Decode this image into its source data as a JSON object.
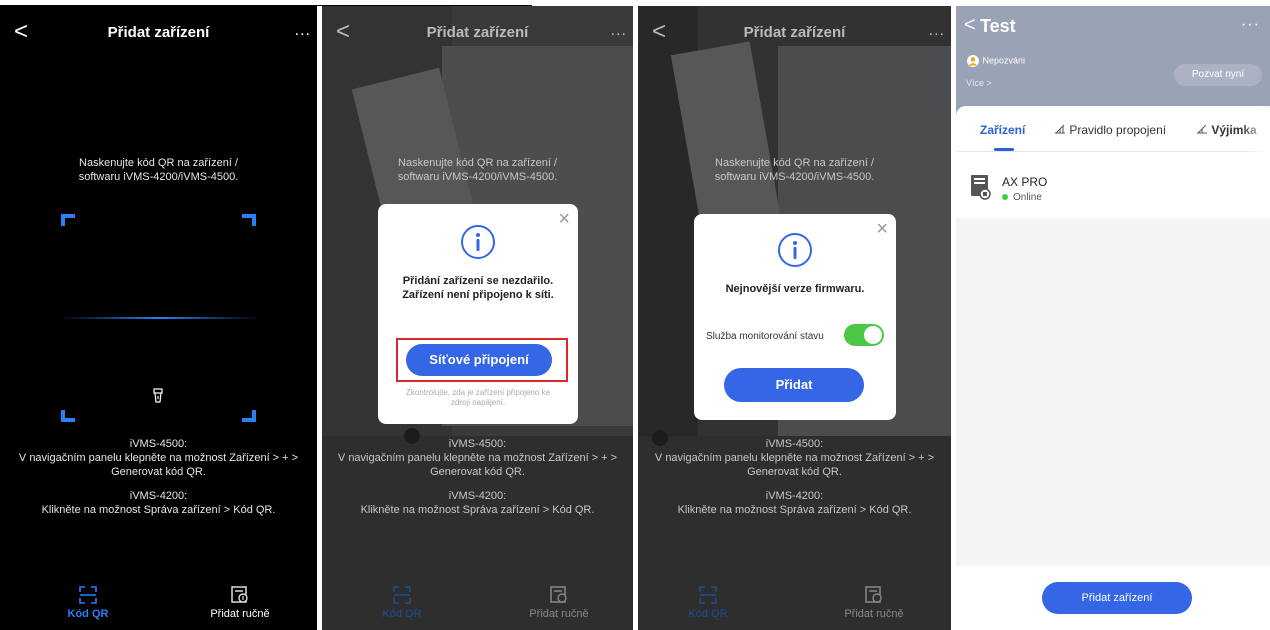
{
  "panel1": {
    "header": {
      "back": "<",
      "title": "Přidat zařízení",
      "more": "..."
    },
    "instruction_lines": [
      "Naskenujte kód QR na zařízení /",
      "softwaru iVMS-4200/iVMS-4500."
    ],
    "help": {
      "ivms4500_title": "iVMS-4500:",
      "ivms4500_line1": "V navigačním panelu klepněte na možnost Zařízení > + >",
      "ivms4500_line2": "Generovat kód QR.",
      "ivms4200_title": "iVMS-4200:",
      "ivms4200_line1": "Klikněte na možnost Správa zařízení > Kód QR."
    },
    "tabs": [
      {
        "label": "Kód QR",
        "icon": "qr-scan-icon",
        "active": true
      },
      {
        "label": "Přidat ručně",
        "icon": "manual-add-icon",
        "active": false
      }
    ]
  },
  "panel2": {
    "header": {
      "back": "<",
      "title": "Přidat zařízení",
      "more": "..."
    },
    "dialog": {
      "close": "×",
      "icon": "info-icon",
      "message_line1": "Přidání zařízení se nezdařilo.",
      "message_line2": "Zařízení není připojeno k síti.",
      "button": "Síťové připojení",
      "hint_line1": "Zkontrolujte, zda je zařízení připojeno ke",
      "hint_line2": "zdroji napájení."
    }
  },
  "panel3": {
    "header": {
      "back": "<",
      "title": "Přidat zařízení",
      "more": "..."
    },
    "dialog": {
      "close": "×",
      "icon": "info-icon",
      "message": "Nejnovější verze firmwaru.",
      "toggle_label": "Služba monitorování stavu",
      "toggle_on": true,
      "button": "Přidat"
    }
  },
  "panel4": {
    "header": {
      "back": "<",
      "title": "Test",
      "more": "···"
    },
    "status": "Nepozváni",
    "more_link": "Více >",
    "invite_button": "Pozvat nyní",
    "tabs": [
      {
        "label": "Zařízení",
        "active": true
      },
      {
        "label": "Pravidlo propojení",
        "icon": "link-rule-icon",
        "active": false
      },
      {
        "label": "Výjimka",
        "icon": "exception-icon",
        "active": false
      }
    ],
    "device": {
      "name": "AX PRO",
      "status": "Online",
      "icon": "alarm-panel-icon"
    },
    "add_button": "Přidat zařízení"
  },
  "colors": {
    "accent": "#3566e6",
    "scan_blue": "#2a7ff5",
    "highlight_red": "#e0242b",
    "toggle_green": "#4cc744"
  }
}
